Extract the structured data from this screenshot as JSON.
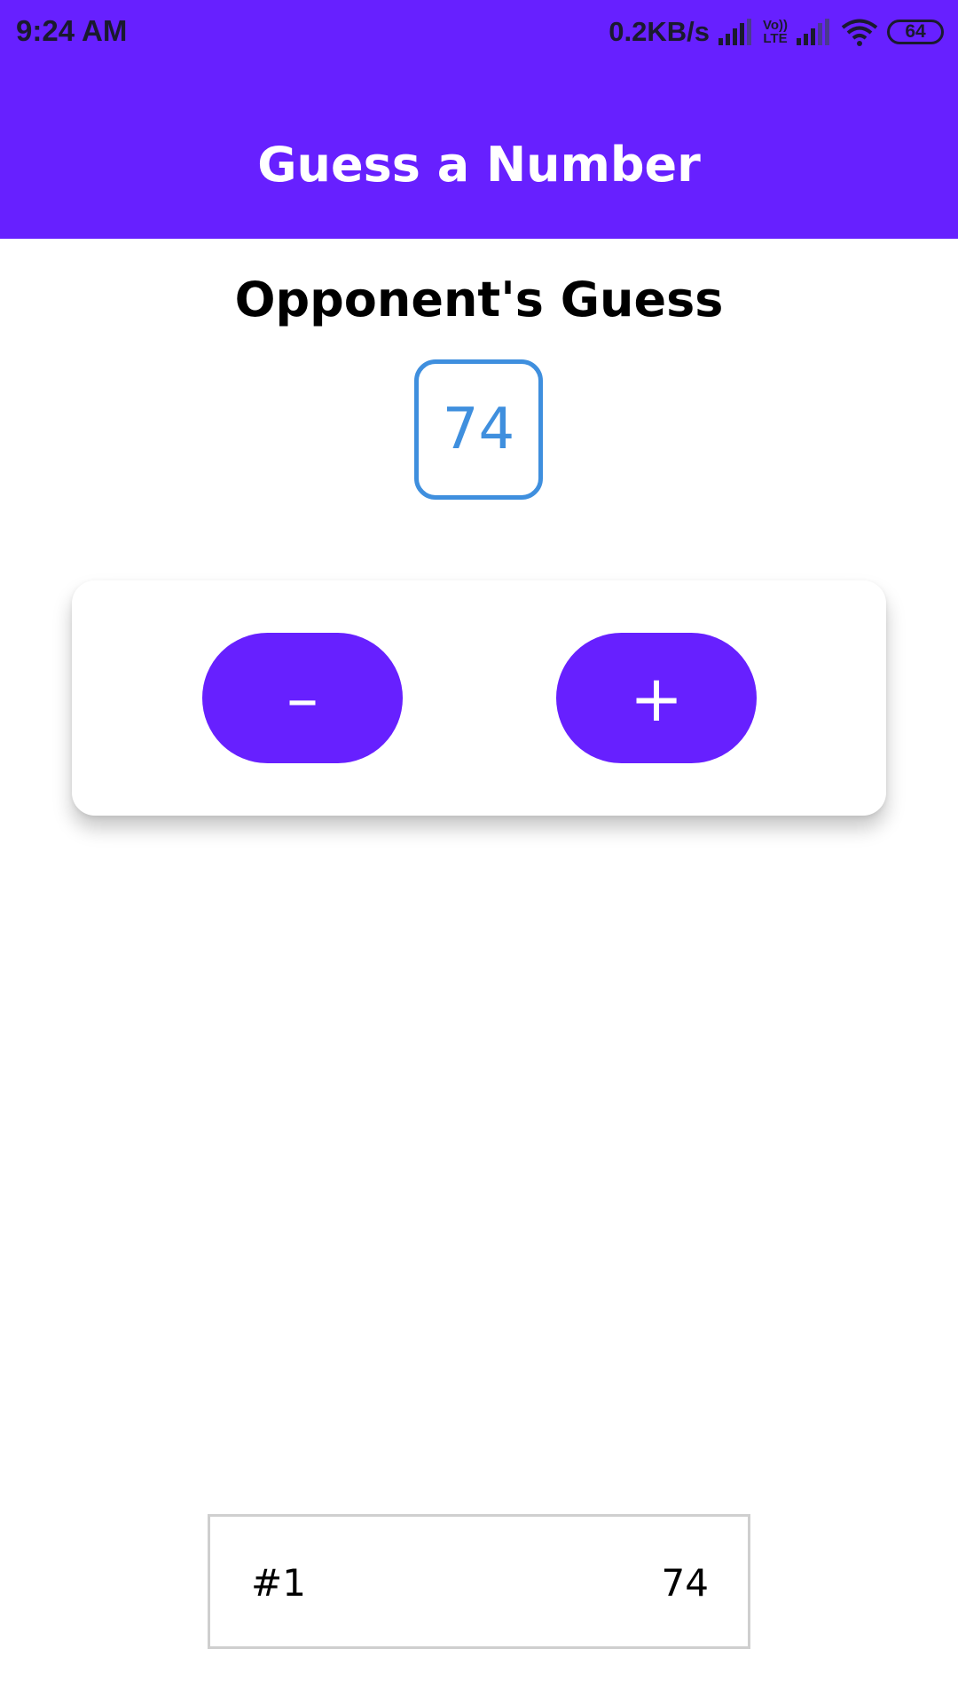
{
  "status_bar": {
    "time": "9:24 AM",
    "net_speed": "0.2KB/s",
    "volte_top": "Vo))",
    "volte_bottom": "LTE",
    "battery": "64",
    "icons": [
      "signal-icon",
      "volte-icon",
      "signal-icon",
      "wifi-icon",
      "battery-icon"
    ]
  },
  "header": {
    "title": "Guess a Number"
  },
  "game": {
    "heading": "Opponent's Guess",
    "current_guess": "74",
    "lower_label": "–",
    "higher_label": "+"
  },
  "history": [
    {
      "round": "#1",
      "value": "74"
    }
  ],
  "colors": {
    "primary": "#6720ff",
    "guess_accent": "#3f8fde",
    "history_border": "#cfcfcf"
  }
}
